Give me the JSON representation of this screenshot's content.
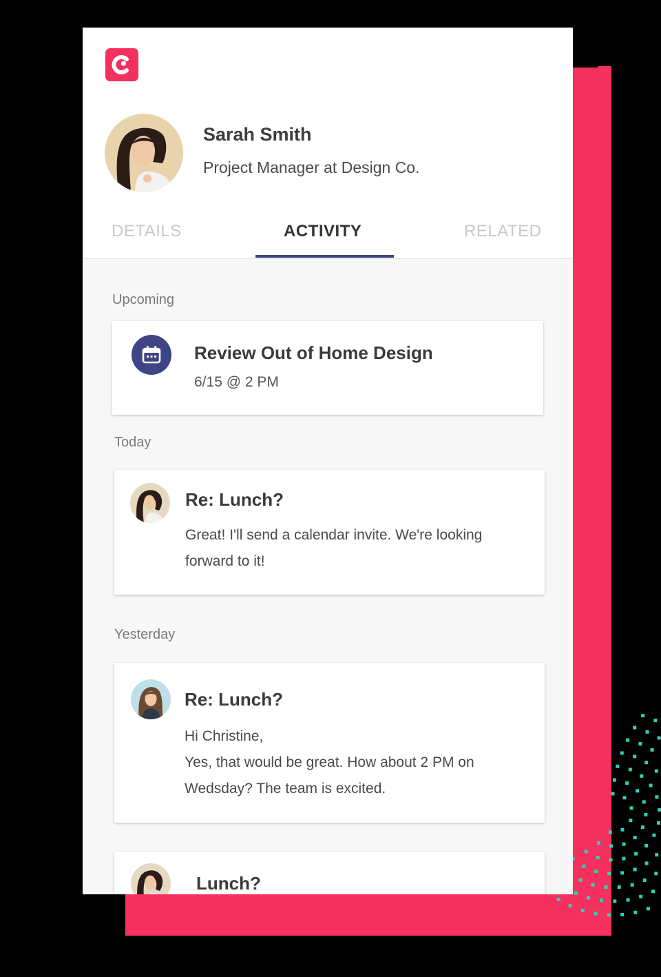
{
  "brand": {
    "logo_letter": "c",
    "accent": "#f4305e",
    "primary": "#3f4584",
    "dots_color": "#2ad3b4"
  },
  "profile": {
    "name": "Sarah Smith",
    "role": "Project Manager at Design Co."
  },
  "tabs": [
    {
      "label": "DETAILS",
      "active": false
    },
    {
      "label": "ACTIVITY",
      "active": true
    },
    {
      "label": "RELATED",
      "active": false
    }
  ],
  "feed": {
    "upcoming": {
      "label": "Upcoming",
      "event": {
        "icon": "calendar-icon",
        "title": "Review Out of Home Design",
        "when": "6/15 @ 2 PM"
      }
    },
    "today": {
      "label": "Today",
      "message": {
        "title": "Re: Lunch?",
        "body": "Great! I'll send a calendar invite. We're looking forward to it!"
      }
    },
    "yesterday": {
      "label": "Yesterday",
      "message": {
        "title": "Re: Lunch?",
        "line1": "Hi Christine,",
        "line2": "Yes, that would be great. How about 2 PM on Wedsday? The team is excited."
      }
    },
    "earlier": {
      "message": {
        "title": "Lunch?"
      }
    }
  }
}
